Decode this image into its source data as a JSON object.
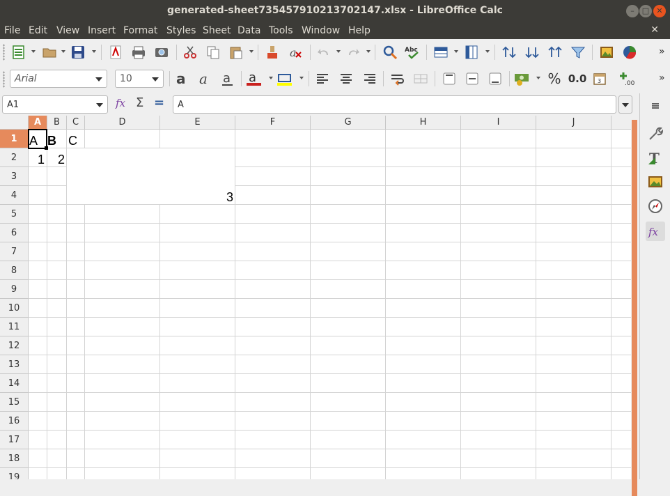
{
  "window": {
    "title": "generated-sheet735457910213702147.xlsx - LibreOffice Calc"
  },
  "menu": [
    "File",
    "Edit",
    "View",
    "Insert",
    "Format",
    "Styles",
    "Sheet",
    "Data",
    "Tools",
    "Window",
    "Help"
  ],
  "formatting": {
    "font_name": "Arial",
    "font_size": "10",
    "percent": "%",
    "decimal": "0.0"
  },
  "formula_bar": {
    "name_box": "A1",
    "content": "A",
    "fx": "fx",
    "sum": "Σ",
    "equals": "="
  },
  "columns": [
    "A",
    "B",
    "C",
    "D",
    "E",
    "F",
    "G",
    "H",
    "I",
    "J"
  ],
  "rows": [
    "1",
    "2",
    "3",
    "4",
    "5",
    "6",
    "7",
    "8",
    "9",
    "10",
    "11",
    "12",
    "13",
    "14",
    "15",
    "16",
    "17",
    "18",
    "19"
  ],
  "cells": {
    "A1": "A",
    "B1": "B",
    "C1": "C",
    "A2": "1",
    "B2": "2",
    "merged_C2_E4": "3"
  },
  "colors": {
    "accent": "#e68a5c",
    "titlebar": "#3c3b37",
    "close": "#e9541f"
  }
}
